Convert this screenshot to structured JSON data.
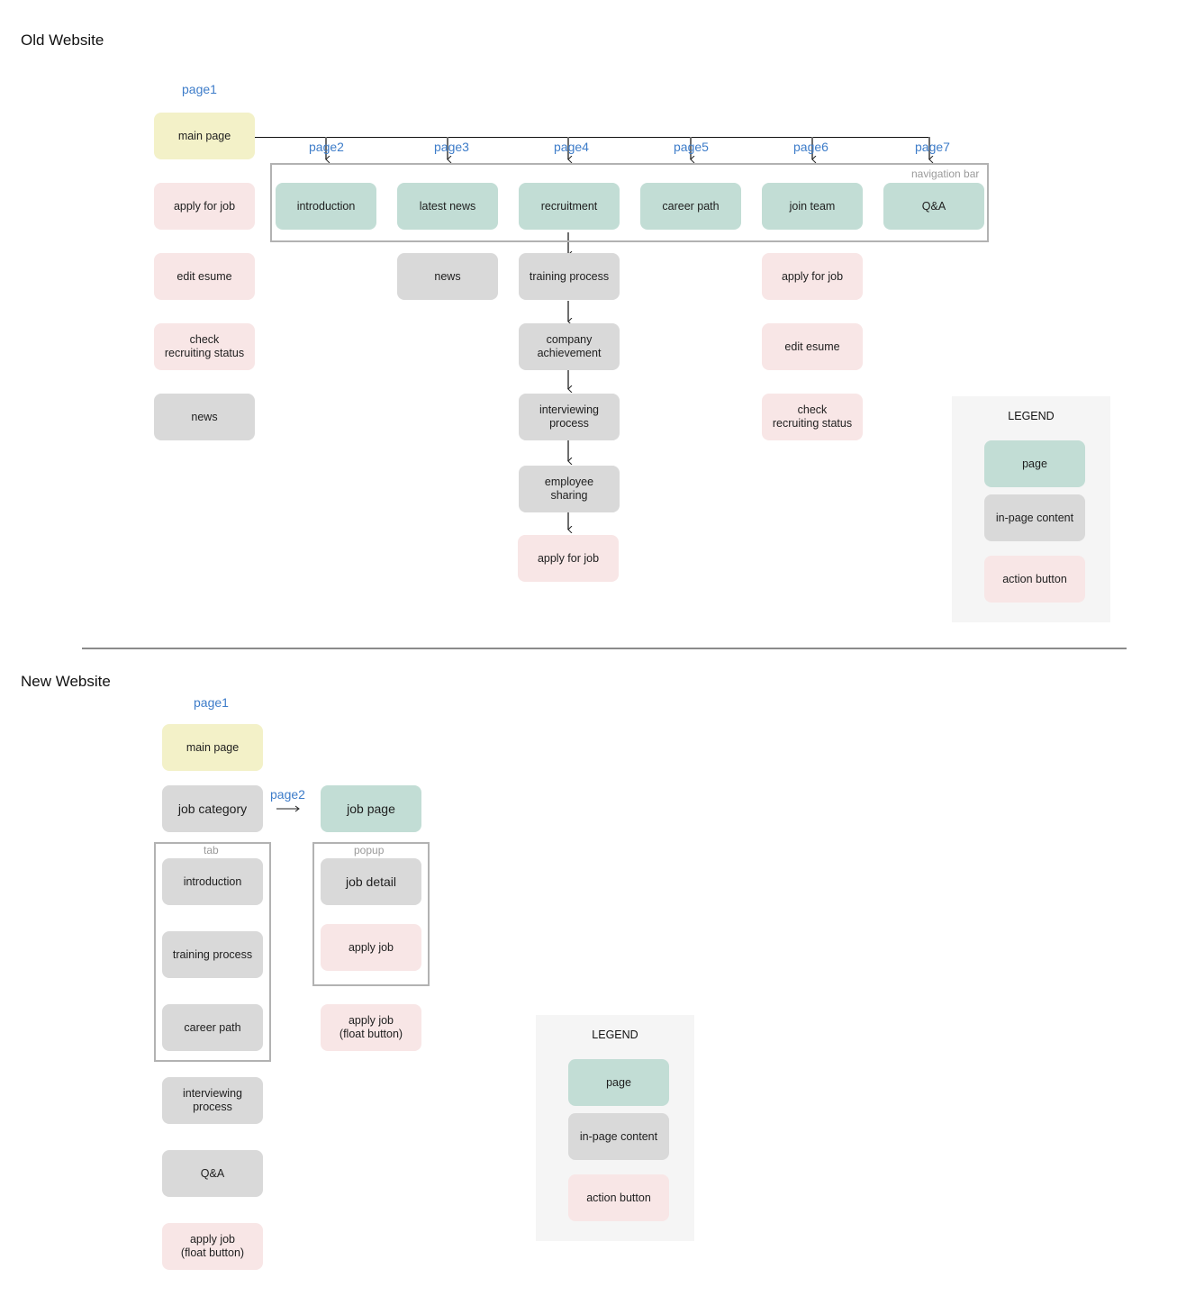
{
  "old_website": {
    "title": "Old Website",
    "page1_label": "page1",
    "main_page": "main page",
    "main_column": [
      "apply for job",
      "edit esume",
      "check\nrecruiting status",
      "news"
    ],
    "nav_bar_label": "navigation bar",
    "nav_pages": [
      {
        "page_label": "page2",
        "name": "introduction"
      },
      {
        "page_label": "page3",
        "name": "latest news"
      },
      {
        "page_label": "page4",
        "name": "recruitment"
      },
      {
        "page_label": "page5",
        "name": "career path"
      },
      {
        "page_label": "page6",
        "name": "join team"
      },
      {
        "page_label": "page7",
        "name": "Q&A"
      }
    ],
    "latest_news_children": [
      "news"
    ],
    "recruitment_flow": [
      "training process",
      "company\nachievement",
      "interviewing\nprocess",
      "employee\nsharing",
      "apply for job"
    ],
    "join_team_children": [
      "apply for job",
      "edit esume",
      "check\nrecruiting status"
    ],
    "legend": {
      "title": "LEGEND",
      "items": [
        "page",
        "in-page content",
        "action button"
      ]
    }
  },
  "new_website": {
    "title": "New Website",
    "page1_label": "page1",
    "main_page": "main page",
    "job_category": "job category",
    "page2_label": "page2",
    "job_page": "job page",
    "tab_label": "tab",
    "tab_items": [
      "introduction",
      "training process",
      "career path"
    ],
    "after_tab": [
      "interviewing\nprocess",
      "Q&A"
    ],
    "float_button": "apply  job\n(float button)",
    "popup_label": "popup",
    "popup_items": {
      "detail": "job detail",
      "apply": "apply job"
    },
    "job_page_float_button": "apply job\n(float button)",
    "legend": {
      "title": "LEGEND",
      "items": [
        "page",
        "in-page content",
        "action button"
      ]
    }
  },
  "colors": {
    "main_page": "#f3f1c8",
    "page": "#c2ddd5",
    "in_page_content": "#d9d9d9",
    "action_button": "#f8e6e6",
    "page_label": "#3d7cc9"
  }
}
